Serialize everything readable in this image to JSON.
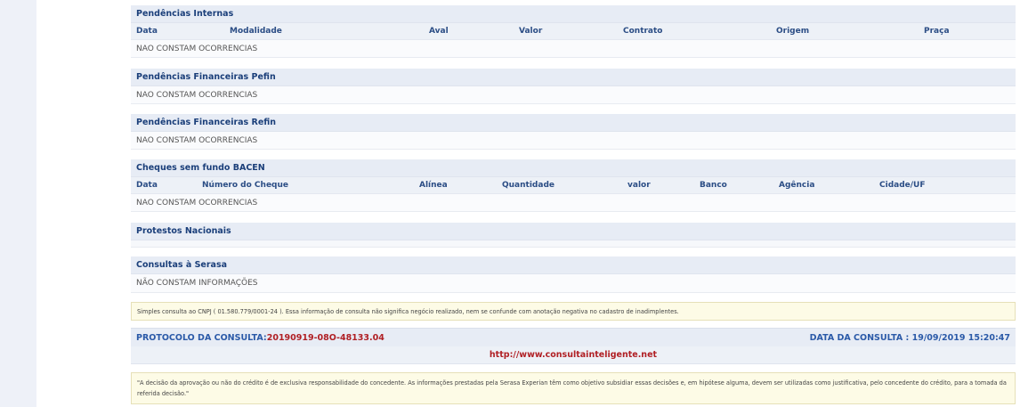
{
  "internas": {
    "title": "Pendências Internas",
    "headers": [
      "Data",
      "Modalidade",
      "Aval",
      "Valor",
      "Contrato",
      "Origem",
      "Praça"
    ],
    "value": "NAO CONSTAM OCORRENCIAS"
  },
  "pefin": {
    "title": "Pendências Financeiras Pefin",
    "value": "NAO CONSTAM OCORRENCIAS"
  },
  "refin": {
    "title": "Pendências Financeiras Refin",
    "value": "NAO CONSTAM OCORRENCIAS"
  },
  "cheques": {
    "title": "Cheques sem fundo BACEN",
    "headers": [
      "Data",
      "Número do Cheque",
      "Alínea",
      "Quantidade",
      "valor",
      "Banco",
      "Agência",
      "Cidade/UF"
    ],
    "value": "NAO CONSTAM OCORRENCIAS"
  },
  "protestos": {
    "title": "Protestos Nacionais"
  },
  "consultas": {
    "title": "Consultas à Serasa",
    "value": "NÃO CONSTAM INFORMAÇÕES"
  },
  "notes": {
    "cnpj": "Simples consulta ao CNPJ ( 01.580.779/0001-24 ). Essa informação de consulta não significa negócio realizado, nem se confunde com anotação negativa no cadastro de inadimplentes.",
    "disclaimer": "\"A decisão da aprovação ou não do crédito é de exclusiva responsabilidade do concedente. As informações prestadas pela Serasa Experian têm como objetivo subsidiar essas decisões e, em hipótese alguma, devem ser utilizadas como justificativa, pelo concedente do crédito, para a tomada da referida decisão.\""
  },
  "protocol": {
    "label": "PROTOCOLO DA CONSULTA:",
    "value": "20190919-08O-48133.04",
    "date_label": "DATA DA CONSULTA : ",
    "date_value": "19/09/2019 15:20:47",
    "link": "http://www.consultainteligente.net"
  }
}
